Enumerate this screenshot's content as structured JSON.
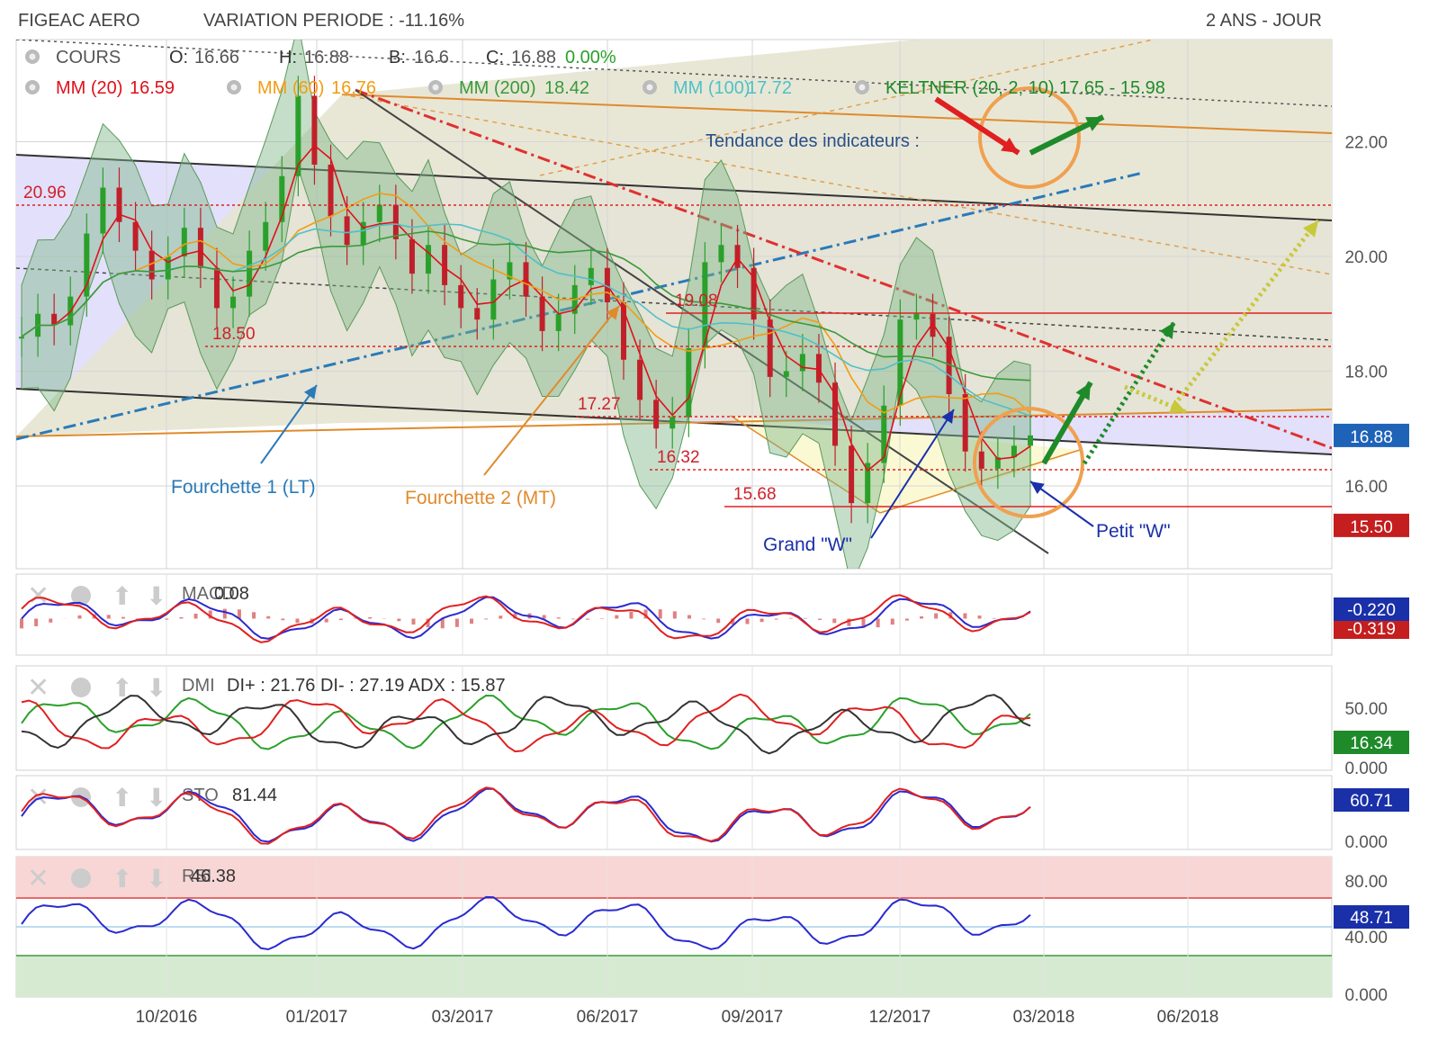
{
  "header": {
    "title": "FIGEAC AERO",
    "variation": "VARIATION PERIODE : -11.16%",
    "period": "2 ANS - JOUR"
  },
  "legend": {
    "cours_label": "COURS",
    "ohlc": [
      {
        "k": "O:",
        "v": "16.66"
      },
      {
        "k": "H:",
        "v": "16.88"
      },
      {
        "k": "B:",
        "v": "16.6"
      },
      {
        "k": "C:",
        "v": "16.88"
      }
    ],
    "change": "0.00%",
    "mm": [
      {
        "label": "MM (20)",
        "value": "16.59",
        "color": "#e0101b"
      },
      {
        "label": "MM (60)",
        "value": "16.76",
        "color": "#f39c12"
      },
      {
        "label": "MM (200)",
        "value": "18.42",
        "color": "#3a9a3a"
      },
      {
        "label": "MM (100)",
        "value": "17.72",
        "color": "#4fc0c7"
      }
    ],
    "keltner": "KELTNER (20, 2, 10) 17.65 - 15.98"
  },
  "annotations": {
    "trend": "Tendance des indicateurs :",
    "fork1": "Fourchette 1 (LT)",
    "fork2": "Fourchette 2 (MT)",
    "grand_w": "Grand \"W\"",
    "petit_w": "Petit \"W\""
  },
  "chart_data": [
    {
      "type": "line",
      "name": "price",
      "x": [
        "10/2016",
        "01/2017",
        "03/2017",
        "06/2017",
        "09/2017",
        "12/2017",
        "03/2018",
        "06/2018"
      ],
      "y_ticks": [
        "22.00",
        "20.00",
        "18.00",
        "16.00"
      ],
      "levels": [
        "20.96",
        "18.50",
        "19.08",
        "17.27",
        "16.32",
        "15.68"
      ],
      "last_price": "16.88",
      "support": "15.50",
      "closes": [
        18.6,
        19.0,
        18.8,
        19.3,
        20.4,
        21.2,
        20.6,
        20.1,
        19.6,
        20.0,
        20.5,
        19.8,
        19.1,
        19.3,
        20.1,
        20.6,
        21.4,
        22.8,
        21.6,
        20.7,
        20.2,
        20.6,
        20.9,
        20.3,
        19.7,
        20.2,
        19.5,
        19.1,
        18.9,
        19.6,
        19.9,
        19.3,
        18.7,
        19.0,
        19.5,
        19.8,
        19.2,
        18.2,
        17.5,
        17.0,
        17.2,
        18.4,
        19.9,
        20.2,
        19.8,
        18.9,
        17.9,
        18.0,
        18.3,
        17.8,
        16.7,
        15.7,
        16.4,
        17.4,
        18.9,
        19.0,
        18.6,
        17.6,
        16.6,
        16.3,
        16.5,
        16.7,
        16.88
      ]
    },
    {
      "type": "line",
      "name": "MACD",
      "label": "MACD",
      "value": "0.08",
      "badges": [
        "-0.220",
        "-0.319"
      ]
    },
    {
      "type": "line",
      "name": "DMI",
      "label": "DMI",
      "value": "DI+ : 21.76 DI- : 27.19 ADX : 15.87",
      "y_ticks": [
        "50.00",
        "0.000"
      ],
      "badge": "16.34"
    },
    {
      "type": "line",
      "name": "STO",
      "label": "STO",
      "value": "81.44",
      "y_ticks": [
        "0.000"
      ],
      "badge": "60.71"
    },
    {
      "type": "line",
      "name": "RSI",
      "label": "RSI",
      "value": "46.38",
      "y_ticks": [
        "80.00",
        "40.00",
        "0.000"
      ],
      "badge": "48.71"
    }
  ]
}
